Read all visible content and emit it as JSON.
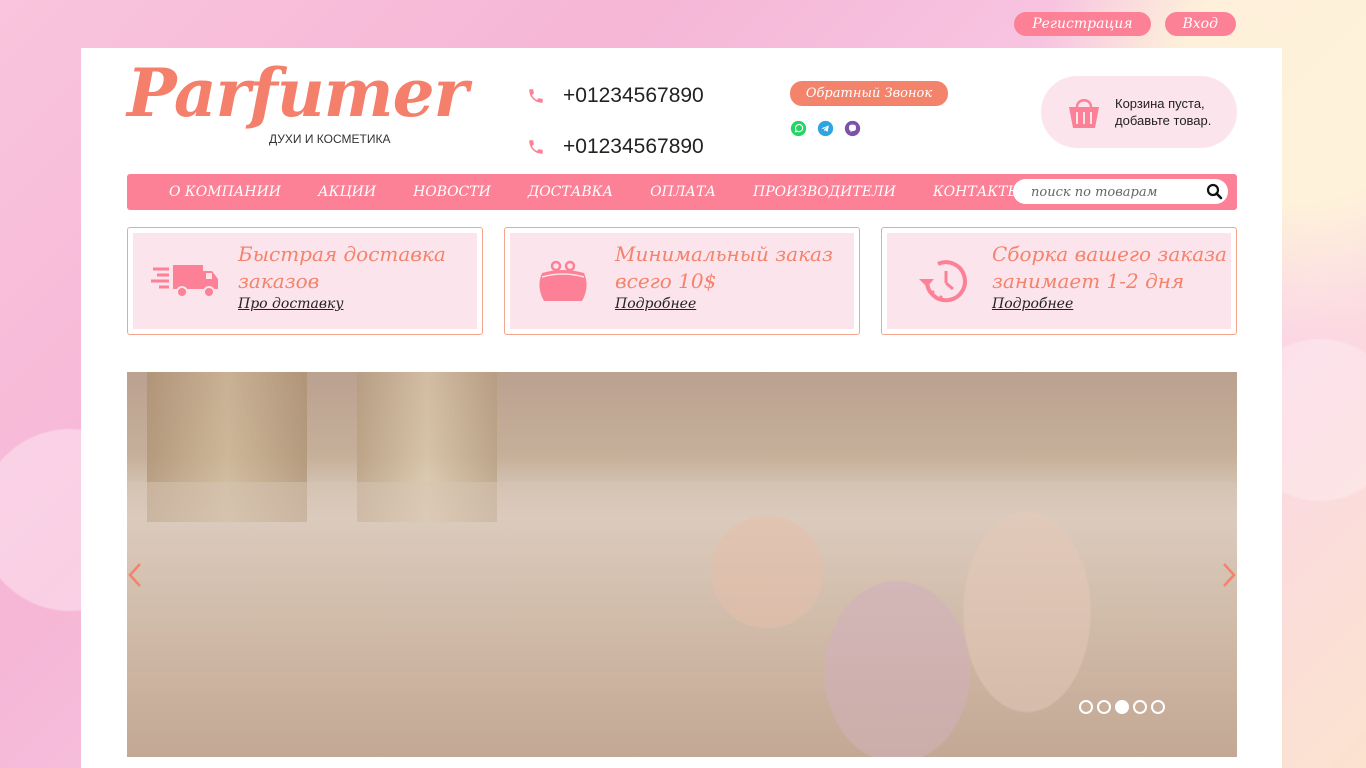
{
  "auth": {
    "register_label": "Регистрация",
    "login_label": "Вход"
  },
  "logo": {
    "text": "Parfumer",
    "subtitle": "ДУХИ И КОСМЕТИКА"
  },
  "phones": [
    "+01234567890",
    "+01234567890"
  ],
  "callback_label": "Обратный Звонок",
  "messengers": [
    "whatsapp-icon",
    "telegram-icon",
    "viber-icon"
  ],
  "cart": {
    "line1": "Корзина пуста,",
    "line2": "добавьте товар."
  },
  "nav": {
    "items": [
      "О КОМПАНИИ",
      "АКЦИИ",
      "НОВОСТИ",
      "ДОСТАВКА",
      "ОПЛАТА",
      "ПРОИЗВОДИТЕЛИ",
      "КОНТАКТЫ"
    ]
  },
  "search": {
    "placeholder": "поиск по товарам"
  },
  "features": [
    {
      "title": "Быстрая доставка заказов",
      "link": "Про доставку",
      "icon": "truck-icon"
    },
    {
      "title": "Минимальный заказ всего 10$",
      "link": "Подробнее",
      "icon": "purse-icon"
    },
    {
      "title": "Сборка вашего заказа занимает 1-2 дня",
      "link": "Подробнее",
      "icon": "clock-icon"
    }
  ],
  "slider": {
    "dots": 5,
    "active_dot": 3
  },
  "colors": {
    "accent": "#fc8096",
    "coral": "#f4836b",
    "soft_pink": "#fce4ec"
  }
}
